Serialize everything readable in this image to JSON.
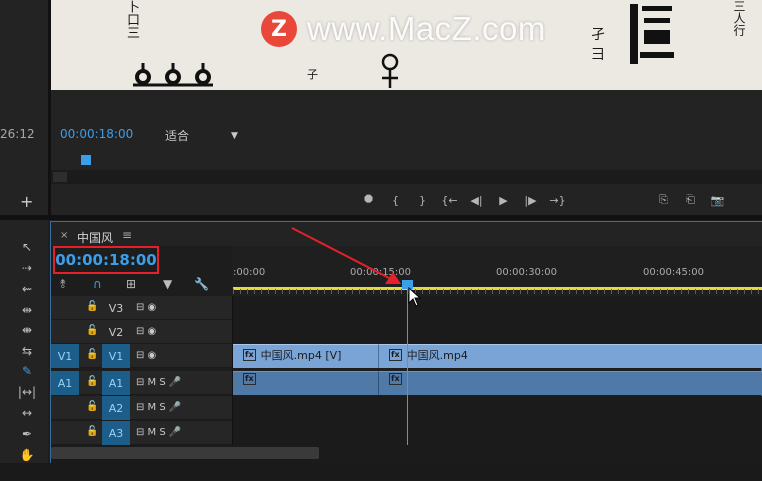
{
  "watermark": {
    "logo": "Z",
    "text": "www.MacZ.com"
  },
  "left_panel": {
    "timecode": "26:12",
    "add_label": "+"
  },
  "program_monitor": {
    "timecode": "00:00:18:00",
    "fit_value": "适合",
    "fit_caret": "▼",
    "transport": [
      "⯃",
      "{",
      "}",
      "{←",
      "◀|",
      "▶",
      "|▶",
      "→}",
      "⎘",
      "⎗",
      "📷"
    ]
  },
  "tools": [
    "↖",
    "⇢",
    "⇜",
    "⇹",
    "⇼",
    "⇆",
    "✎",
    "|↔|",
    "↔",
    "✒",
    "✋"
  ],
  "timeline": {
    "close_icon": "×",
    "title": "中国风",
    "menu_icon": "≡",
    "timecode": "00:00:18:00",
    "ruler_labels": [
      ":00:00",
      "00:00:15:00",
      "00:00:30:00",
      "00:00:45:00"
    ],
    "tracks": [
      {
        "src": "",
        "lock": "🔓",
        "target": "V3",
        "icons": "⊟ ◉"
      },
      {
        "src": "",
        "lock": "🔓",
        "target": "V2",
        "icons": "⊟ ◉"
      },
      {
        "src": "V1",
        "lock": "🔓",
        "target": "V1",
        "icons": "⊟ ◉"
      },
      {
        "src": "A1",
        "lock": "🔓",
        "target": "A1",
        "icons": "⊟ M S 🎤"
      },
      {
        "src": "",
        "lock": "🔓",
        "target": "A2",
        "icons": "⊟ M S 🎤"
      },
      {
        "src": "",
        "lock": "🔓",
        "target": "A3",
        "icons": "⊟ M S 🎤"
      }
    ],
    "clips": {
      "video_1": "中国风.mp4 [V]",
      "video_2": "中国风.mp4",
      "fx": "fx"
    }
  },
  "colors": {
    "accent": "#3b9ee9",
    "highlight_box": "#e5202b",
    "work_area": "#e3d93a",
    "video_clip": "#7aa3d6",
    "audio_clip": "#4f7aa8"
  }
}
